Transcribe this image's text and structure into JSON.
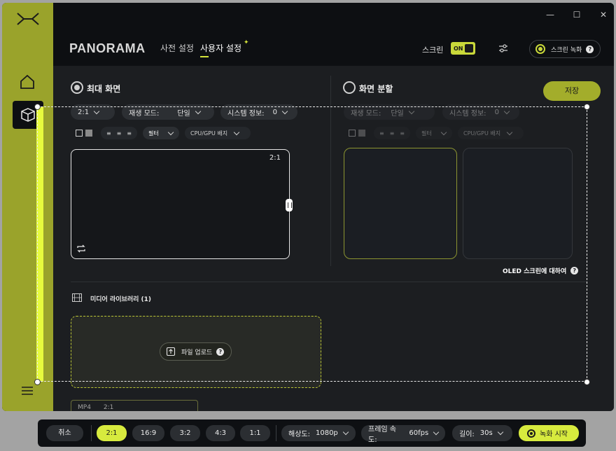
{
  "window": {
    "controls": {
      "minimize": "—",
      "maximize": "☐",
      "close": "✕"
    }
  },
  "header": {
    "brand": "PANORAMA",
    "nav": [
      {
        "label": "사전 설정"
      },
      {
        "label": "사용자 설정"
      }
    ],
    "screen_label": "스크린",
    "screen_toggle": "ON",
    "record_label": "스크린 녹화",
    "help": "?"
  },
  "panel_full": {
    "title": "최대 화면",
    "ratio": "2:1",
    "play_mode_label": "재생 모드:",
    "play_mode_value": "단일",
    "sysinfo_label": "시스템 정보:",
    "sysinfo_value": "0",
    "filter_label": "필터",
    "badge_label": "CPU/GPU 배지",
    "preview_ratio": "2:1"
  },
  "panel_split": {
    "title": "화면 분할",
    "save": "저장",
    "play_mode_label": "재생 모드:",
    "play_mode_value": "단일",
    "sysinfo_label": "시스템 정보:",
    "sysinfo_value": "0",
    "filter_label": "필터",
    "badge_label": "CPU/GPU 배지",
    "oled_text": "OLED 스크린에 대하여"
  },
  "media": {
    "title": "미디어 라이브러리 (1)",
    "upload_label": "파일 업로드",
    "file_format": "MP4",
    "file_ratio": "2:1"
  },
  "bottom_bar": {
    "cancel": "취소",
    "ratios": [
      "2:1",
      "16:9",
      "3:2",
      "4:3",
      "1:1"
    ],
    "resolution_label": "해상도:",
    "resolution_value": "1080p",
    "framerate_label": "프레임 속도:",
    "framerate_value": "60fps",
    "length_label": "길이:",
    "length_value": "30s",
    "record_start": "녹화 시작"
  },
  "colors": {
    "accent": "#d7ea3e",
    "sidebar": "#9aa32b",
    "background": "#1c1e21"
  },
  "icons": [
    "logo-icon",
    "home-icon",
    "cube-icon",
    "menu-icon",
    "sliders-icon",
    "film-icon",
    "upload-icon",
    "loop-icon"
  ]
}
